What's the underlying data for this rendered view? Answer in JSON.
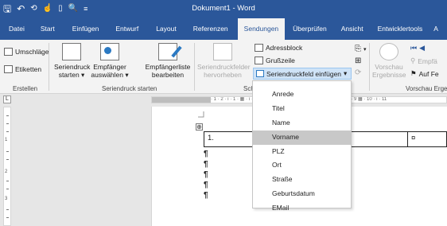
{
  "window": {
    "title": "Dokument1 - Word",
    "qat": [
      "save-icon",
      "undo-icon",
      "redo-icon",
      "touch-mode-icon",
      "new-document-icon",
      "print-preview-icon",
      "customize-icon"
    ]
  },
  "tabs": [
    {
      "label": "Datei"
    },
    {
      "label": "Start"
    },
    {
      "label": "Einfügen"
    },
    {
      "label": "Entwurf"
    },
    {
      "label": "Layout"
    },
    {
      "label": "Referenzen"
    },
    {
      "label": "Sendungen",
      "active": true
    },
    {
      "label": "Überprüfen"
    },
    {
      "label": "Ansicht"
    },
    {
      "label": "Entwicklertools"
    },
    {
      "label": "A"
    }
  ],
  "ribbon": {
    "create_group": {
      "label": "Erstellen",
      "envelopes": "Umschläge",
      "labels": "Etiketten"
    },
    "mailmerge_group": {
      "label": "Seriendruck starten",
      "start_line1": "Seriendruck",
      "start_line2": "starten ▾",
      "recipients_line1": "Empfänger",
      "recipients_line2": "auswählen ▾",
      "edit_line1": "Empfängerliste",
      "edit_line2": "bearbeiten"
    },
    "fields_group": {
      "label": "Sch",
      "highlight_line1": "Seriendruckfelder",
      "highlight_line2": "hervorheben",
      "address_block": "Adressblock",
      "greeting_line": "Grußzeile",
      "insert_field": "Seriendruckfeld einfügen",
      "insert_field_arrow": "▾"
    },
    "preview_group": {
      "label": "Vorschau Erge",
      "preview_line1": "Vorschau",
      "preview_line2": "Ergebnisse",
      "find_recipient": "Empfä",
      "auto_check": "Auf Fe"
    }
  },
  "ruler": {
    "corner": "L",
    "ticks": "· 1 · 2 · ı · 1 · ▦ · ı · 1 · ı · 2 · ı · 3 · ı · 4 · ı · 5 · ı · 6 · ı · 7 · ı · 8 · ı · 9 ▦ · 10 · ı · 11",
    "vertical_numbers": [
      "1",
      "2",
      "3"
    ]
  },
  "document": {
    "table_cell_1": "1.",
    "table_cell_2": "",
    "table_cell_3": "¤",
    "paragraph_mark": "¶",
    "move_handle": "⊕"
  },
  "dropdown": {
    "items": [
      "Anrede",
      "Titel",
      "Name",
      "Vorname",
      "PLZ",
      "Ort",
      "Straße",
      "Geburtsdatum",
      "EMail"
    ],
    "highlighted": "Vorname"
  }
}
